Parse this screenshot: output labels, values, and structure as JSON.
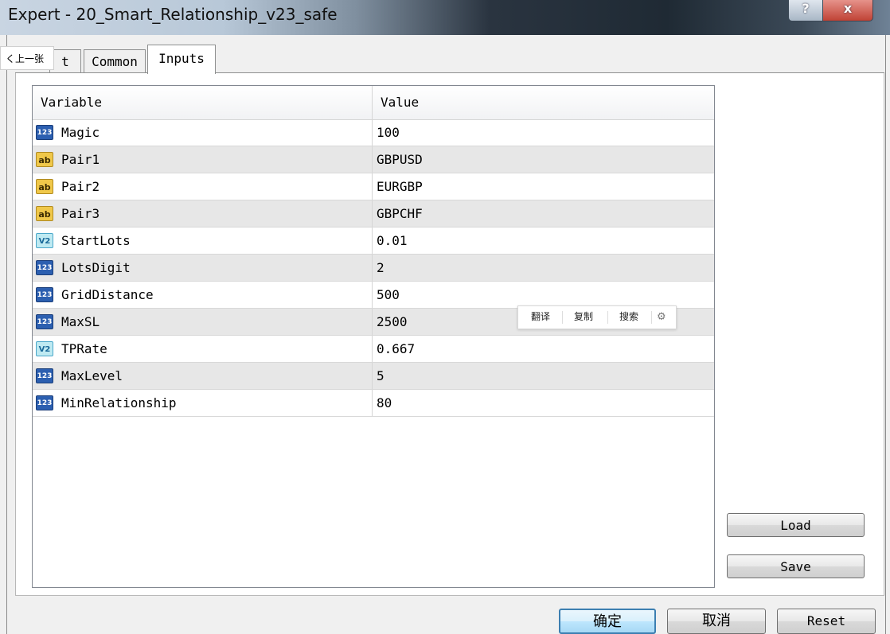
{
  "window": {
    "title": "Expert - 20_Smart_Relationship_v23_safe",
    "help_label": "?",
    "close_label": "x"
  },
  "prev_label": "く上一张",
  "tabs": [
    {
      "label": "t"
    },
    {
      "label": "Common"
    },
    {
      "label": "Inputs"
    }
  ],
  "table": {
    "headers": {
      "variable": "Variable",
      "value": "Value"
    },
    "rows": [
      {
        "icon": "int-type-icon",
        "icon_text": "123",
        "name": "Magic",
        "value": "100"
      },
      {
        "icon": "string-type-icon",
        "icon_text": "ab",
        "name": "Pair1",
        "value": "GBPUSD"
      },
      {
        "icon": "string-type-icon",
        "icon_text": "ab",
        "name": "Pair2",
        "value": "EURGBP"
      },
      {
        "icon": "string-type-icon",
        "icon_text": "ab",
        "name": "Pair3",
        "value": "GBPCHF"
      },
      {
        "icon": "double-type-icon",
        "icon_text": "V2",
        "name": "StartLots",
        "value": "0.01"
      },
      {
        "icon": "int-type-icon",
        "icon_text": "123",
        "name": "LotsDigit",
        "value": "2"
      },
      {
        "icon": "int-type-icon",
        "icon_text": "123",
        "name": "GridDistance",
        "value": "500"
      },
      {
        "icon": "int-type-icon",
        "icon_text": "123",
        "name": "MaxSL",
        "value": "2500"
      },
      {
        "icon": "double-type-icon",
        "icon_text": "V2",
        "name": "TPRate",
        "value": "0.667"
      },
      {
        "icon": "int-type-icon",
        "icon_text": "123",
        "name": "MaxLevel",
        "value": "5"
      },
      {
        "icon": "int-type-icon",
        "icon_text": "123",
        "name": "MinRelationship",
        "value": "80"
      }
    ]
  },
  "context_toolbar": {
    "translate": "翻译",
    "copy": "复制",
    "search": "搜索",
    "settings_icon": "gear-icon"
  },
  "buttons": {
    "load": "Load",
    "save": "Save",
    "ok": "确定",
    "cancel": "取消",
    "reset": "Reset"
  }
}
